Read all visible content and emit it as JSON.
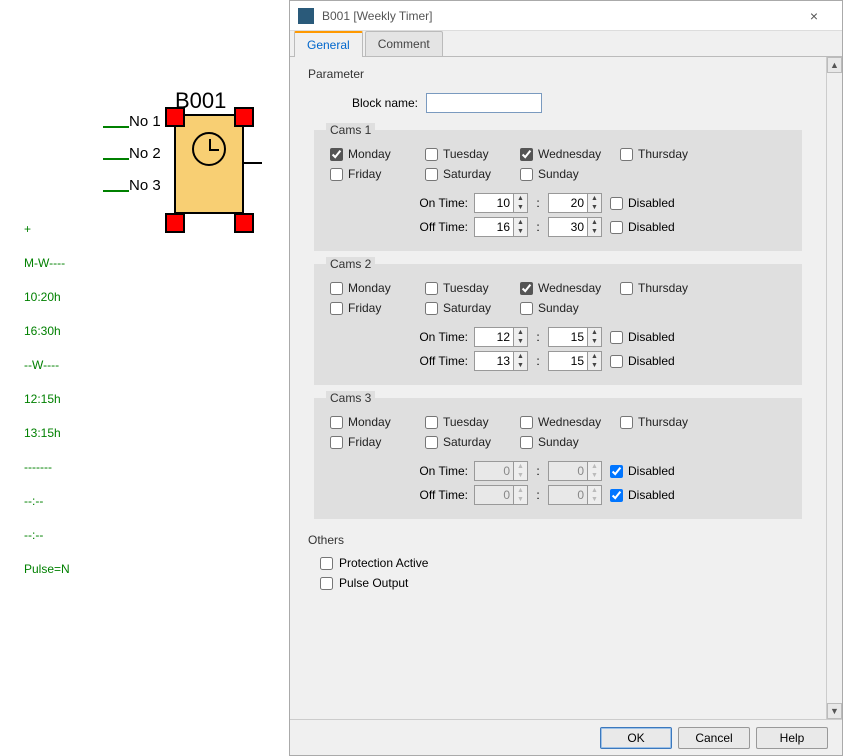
{
  "block": {
    "id": "B001",
    "in1": "No 1",
    "in2": "No 2",
    "in3": "No 3"
  },
  "summary": [
    "+",
    "M-W----",
    "10:20h",
    "16:30h",
    "--W----",
    "12:15h",
    "13:15h",
    "-------",
    "--:--",
    "--:--",
    "Pulse=N"
  ],
  "dialog": {
    "title": "B001 [Weekly Timer]",
    "tabs": {
      "general": "General",
      "comment": "Comment"
    },
    "parameterLegend": "Parameter",
    "blockNameLabel": "Block name:",
    "blockName": "",
    "dayLabels": {
      "mon": "Monday",
      "tue": "Tuesday",
      "wed": "Wednesday",
      "thu": "Thursday",
      "fri": "Friday",
      "sat": "Saturday",
      "sun": "Sunday"
    },
    "onTimeLabel": "On Time:",
    "offTimeLabel": "Off Time:",
    "disabledLabel": "Disabled",
    "cams": [
      {
        "legend": "Cams 1",
        "days": {
          "mon": true,
          "tue": false,
          "wed": true,
          "thu": false,
          "fri": false,
          "sat": false,
          "sun": false
        },
        "onH": "10",
        "onM": "20",
        "onDis": false,
        "offH": "16",
        "offM": "30",
        "offDis": false
      },
      {
        "legend": "Cams 2",
        "days": {
          "mon": false,
          "tue": false,
          "wed": true,
          "thu": false,
          "fri": false,
          "sat": false,
          "sun": false
        },
        "onH": "12",
        "onM": "15",
        "onDis": false,
        "offH": "13",
        "offM": "15",
        "offDis": false
      },
      {
        "legend": "Cams 3",
        "days": {
          "mon": false,
          "tue": false,
          "wed": false,
          "thu": false,
          "fri": false,
          "sat": false,
          "sun": false
        },
        "onH": "0",
        "onM": "0",
        "onDis": true,
        "offH": "0",
        "offM": "0",
        "offDis": true
      }
    ],
    "othersLegend": "Others",
    "protectionLabel": "Protection Active",
    "protection": false,
    "pulseLabel": "Pulse Output",
    "pulse": false,
    "buttons": {
      "ok": "OK",
      "cancel": "Cancel",
      "help": "Help"
    }
  }
}
